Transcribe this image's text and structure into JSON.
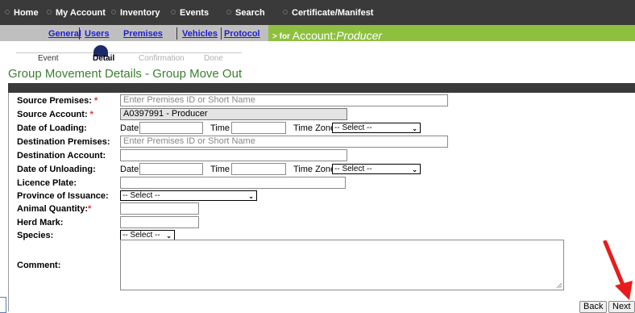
{
  "nav": {
    "items": [
      "Home",
      "My Account",
      "Inventory",
      "Events",
      "Search",
      "Certificate/Manifest"
    ]
  },
  "subnav": {
    "tabs": [
      "General",
      "Users",
      "Premises",
      "Vehicles",
      "Protocol"
    ],
    "for_prefix": "> for",
    "account_label": "Account:",
    "account_name": "Producer"
  },
  "steps": {
    "labels": [
      "Event",
      "Detail",
      "Confirmation",
      "Done"
    ],
    "active": "Detail"
  },
  "page_title": "Group Movement Details - Group Move Out",
  "form": {
    "source_premises": {
      "label": "Source Premises:",
      "required": "*",
      "placeholder": "Enter Premises ID or Short Name"
    },
    "source_account": {
      "label": "Source Account:",
      "required": "*",
      "value": "A0397991 - Producer"
    },
    "date_of_loading": {
      "label": "Date of Loading:",
      "date_label": "Date",
      "time_label": "Time",
      "tz_label": "Time Zone",
      "tz_value": "-- Select --"
    },
    "destination_premises": {
      "label": "Destination Premises:",
      "placeholder": "Enter Premises ID or Short Name"
    },
    "destination_account": {
      "label": "Destination Account:"
    },
    "date_of_unloading": {
      "label": "Date of Unloading:",
      "date_label": "Date",
      "time_label": "Time",
      "tz_label": "Time Zone",
      "tz_value": "-- Select --"
    },
    "licence_plate": {
      "label": "Licence Plate:"
    },
    "province": {
      "label": "Province of Issuance:",
      "value": "-- Select --"
    },
    "animal_quantity": {
      "label": "Animal Quantity:",
      "required": "*"
    },
    "herd_mark": {
      "label": "Herd Mark:"
    },
    "species": {
      "label": "Species:",
      "value": "-- Select --"
    },
    "comment": {
      "label": "Comment:"
    }
  },
  "buttons": {
    "back": "Back",
    "next": "Next"
  },
  "colors": {
    "nav_bg": "#3a3a3a",
    "subnav_grey": "#bfbfbf",
    "subnav_green": "#8fbf3f",
    "title_green": "#3b7f2e",
    "annotation_arrow": "#e81c1c"
  }
}
